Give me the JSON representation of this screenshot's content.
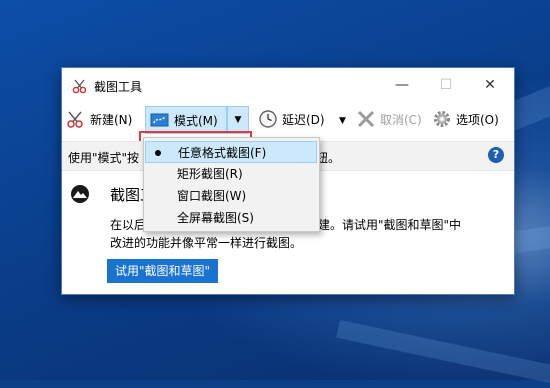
{
  "window": {
    "title": "截图工具",
    "minimize_symbol": "—",
    "maximize_symbol": "☐",
    "close_symbol": "✕"
  },
  "toolbar": {
    "new_label": "新建(N)",
    "mode_label": "模式(M)",
    "delay_label": "延迟(D)",
    "cancel_label": "取消(C)",
    "options_label": "选项(O)",
    "dropdown_arrow": "▼",
    "cancel_disabled": true
  },
  "info_bar": {
    "text_before": "使用\"模式\"按",
    "text_after": "钮。",
    "help_label": "?"
  },
  "content": {
    "heading": "截图工",
    "line1_left": "在以后",
    "line1_right": "建。请试用\"截图和草图\"中",
    "line2": "改进的功能并像平常一样进行截图。",
    "try_button": "试用\"截图和草图\""
  },
  "mode_menu": {
    "items": [
      {
        "label": "任意格式截图(F)",
        "selected": true
      },
      {
        "label": "矩形截图(R)",
        "selected": false
      },
      {
        "label": "窗口截图(W)",
        "selected": false
      },
      {
        "label": "全屏幕截图(S)",
        "selected": false
      }
    ]
  },
  "icons": {
    "app": "scissors-icon",
    "new": "scissors-new-icon",
    "mode": "freeform-snip-icon",
    "delay": "clock-icon",
    "cancel": "x-icon",
    "options": "gear-icon",
    "help": "help-icon",
    "content": "snip-sketch-icon"
  },
  "colors": {
    "accent": "#1a73d1",
    "selection_bg": "#cde8fb",
    "selection_border": "#99d0f7",
    "highlight_box": "#e53935"
  }
}
